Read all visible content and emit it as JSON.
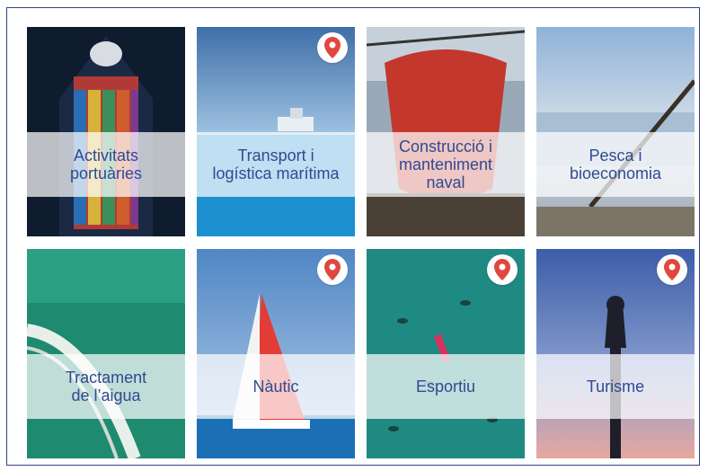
{
  "tiles": [
    {
      "label": "Activitats\nportuàries",
      "has_pin": false
    },
    {
      "label": "Transport i\nlogística marítima",
      "has_pin": true
    },
    {
      "label": "Construcció i\nmanteniment\nnaval",
      "has_pin": false
    },
    {
      "label": "Pesca i\nbioeconomia",
      "has_pin": false
    },
    {
      "label": "Tractament\nde l’aigua",
      "has_pin": false
    },
    {
      "label": "Nàutic",
      "has_pin": true
    },
    {
      "label": "Esportiu",
      "has_pin": true
    },
    {
      "label": "Turisme",
      "has_pin": true
    }
  ],
  "pin_icon": "map-pin-icon",
  "colors": {
    "border": "#2f3f86",
    "label_text": "#2f4a93",
    "pin": "#e0473e"
  }
}
